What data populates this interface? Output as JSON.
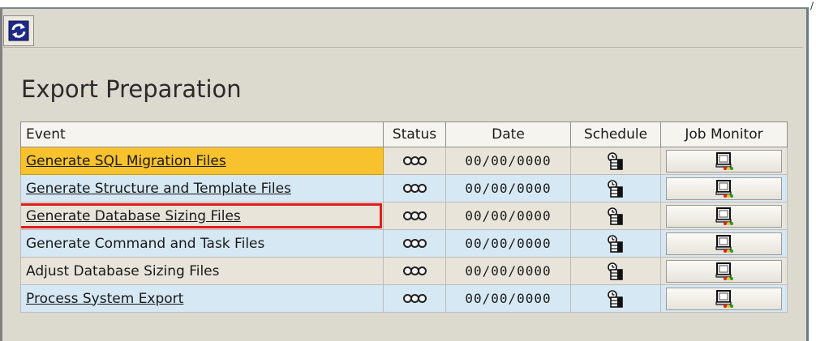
{
  "toolbar": {
    "refresh_icon": "refresh-icon"
  },
  "page": {
    "title": "Export Preparation"
  },
  "table": {
    "headers": {
      "event": "Event",
      "status": "Status",
      "date": "Date",
      "schedule": "Schedule",
      "job_monitor": "Job Monitor"
    },
    "rows": [
      {
        "event": "Generate SQL Migration Files",
        "link": true,
        "highlighted": true,
        "status": "three-circle-status-icon",
        "date": "00/00/0000"
      },
      {
        "event": "Generate Structure and Template Files",
        "link": true,
        "status": "three-circle-status-icon",
        "date": "00/00/0000"
      },
      {
        "event": "Generate Database Sizing Files",
        "link": true,
        "boxed": true,
        "status": "three-circle-status-icon",
        "date": "00/00/0000"
      },
      {
        "event": "Generate Command and Task Files",
        "link": false,
        "status": "three-circle-status-icon",
        "date": "00/00/0000"
      },
      {
        "event": "Adjust Database Sizing Files",
        "link": false,
        "status": "three-circle-status-icon",
        "date": "00/00/0000"
      },
      {
        "event": "Process System Export",
        "link": true,
        "status": "three-circle-status-icon",
        "date": "00/00/0000"
      }
    ]
  },
  "colors": {
    "highlight": "#f7c22d",
    "box_outline": "#e31b1b",
    "odd_row": "#d6e8f4",
    "even_row": "#e8e4da"
  }
}
